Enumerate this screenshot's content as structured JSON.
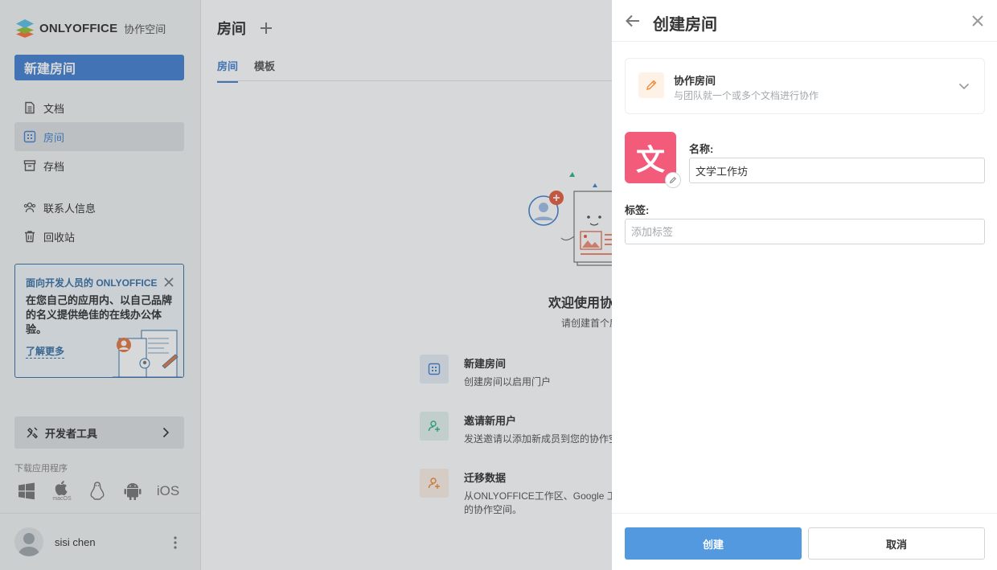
{
  "sidebar": {
    "logo_text": "ONLYOFFICE",
    "logo_sub": "协作空间",
    "new_room_label": "新建房间",
    "nav": [
      {
        "label": "文档",
        "icon": "document-icon",
        "active": false
      },
      {
        "label": "房间",
        "icon": "rooms-icon",
        "active": true
      },
      {
        "label": "存档",
        "icon": "archive-icon",
        "active": false
      },
      {
        "label": "联系人信息",
        "icon": "contacts-icon",
        "active": false
      },
      {
        "label": "回收站",
        "icon": "trash-icon",
        "active": false
      }
    ],
    "promo": {
      "title": "面向开发人员的 ONLYOFFICE",
      "body": "在您自己的应用内、以自己品牌的名义提供绝佳的在线办公体验。",
      "link": "了解更多"
    },
    "dev_tools_label": "开发者工具",
    "downloads_label": "下载应用程序",
    "os": [
      "windows-icon",
      "macos-icon",
      "linux-icon",
      "android-icon",
      "ios-icon"
    ],
    "macos_caption": "macOS",
    "ios_text": "iOS",
    "user_name": "sisi chen"
  },
  "main": {
    "title": "房间",
    "tabs": [
      {
        "label": "房间",
        "active": true
      },
      {
        "label": "模板",
        "active": false
      }
    ],
    "welcome_title": "欢迎使用协",
    "welcome_sub": "请创建首个房",
    "actions": [
      {
        "title": "新建房间",
        "desc": "创建房间以启用门户",
        "color": "#e8eef6",
        "icon_color": "#4781d1"
      },
      {
        "title": "邀请新用户",
        "desc": "发送邀请以添加新成员到您的协作空",
        "color": "#e7f3ef",
        "icon_color": "#2db482"
      },
      {
        "title": "迁移数据",
        "desc": "从ONLYOFFICE工作区、Google 工",
        "desc2": "的协作空间。",
        "color": "#fdf0e6",
        "icon_color": "#f08c3a"
      }
    ]
  },
  "panel": {
    "title": "创建房间",
    "room_type": {
      "title": "协作房间",
      "desc": "与团队就一个或多个文档进行协作"
    },
    "logo_char": "文",
    "logo_color": "#f35b7b",
    "name_label": "名称:",
    "name_value": "文学工作坊",
    "tags_label": "标签:",
    "tags_placeholder": "添加标签",
    "create_label": "创建",
    "cancel_label": "取消"
  }
}
